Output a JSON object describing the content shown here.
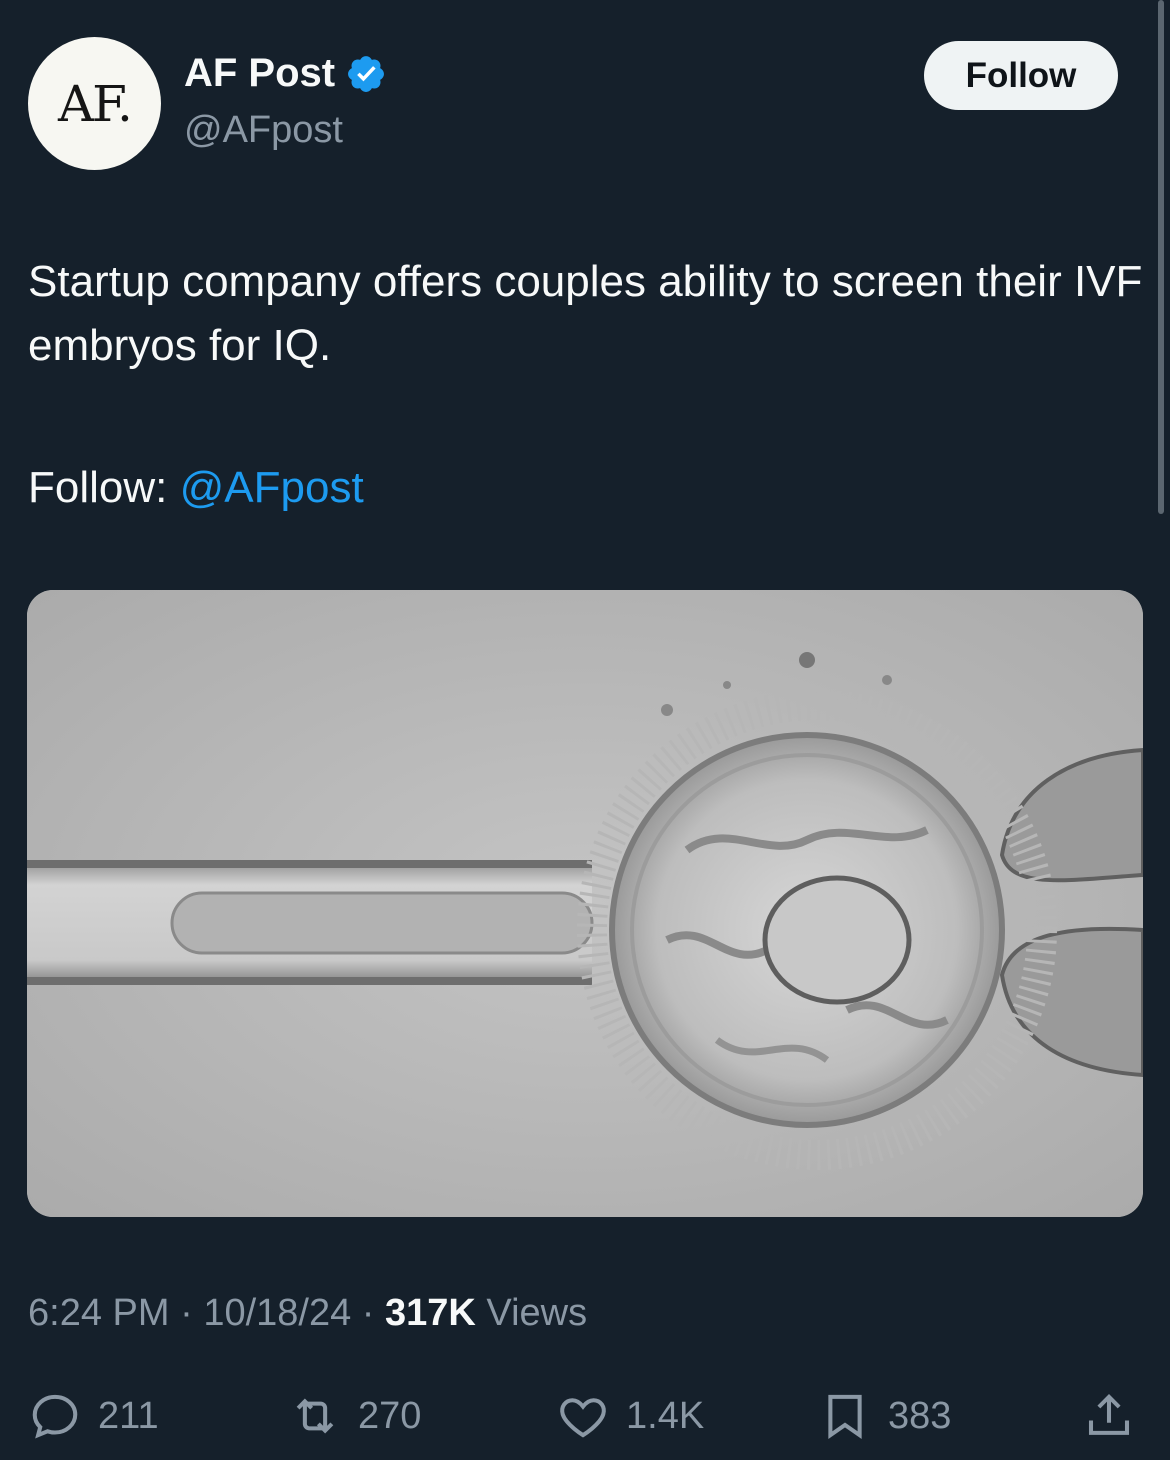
{
  "author": {
    "avatar_text": "AF.",
    "name": "AF Post",
    "handle": "@AFpost",
    "verified_icon": "verified-badge-icon"
  },
  "follow_button": "Follow",
  "tweet": {
    "text": "Startup company offers couples ability to screen their IVF embryos for IQ.",
    "follow_prefix": "Follow:",
    "mention": "@AFpost"
  },
  "media": {
    "icon": "embryo-micrograph-image"
  },
  "meta": {
    "time": "6:24 PM",
    "sep1": "·",
    "date": "10/18/24",
    "sep2": "·",
    "views_count": "317K",
    "views_label": "Views"
  },
  "actions": {
    "replies": "211",
    "reposts": "270",
    "likes": "1.4K",
    "bookmarks": "383"
  },
  "colors": {
    "background": "#15202b",
    "text": "#f7f9f9",
    "muted": "#8b98a5",
    "link": "#1d9bf0"
  }
}
